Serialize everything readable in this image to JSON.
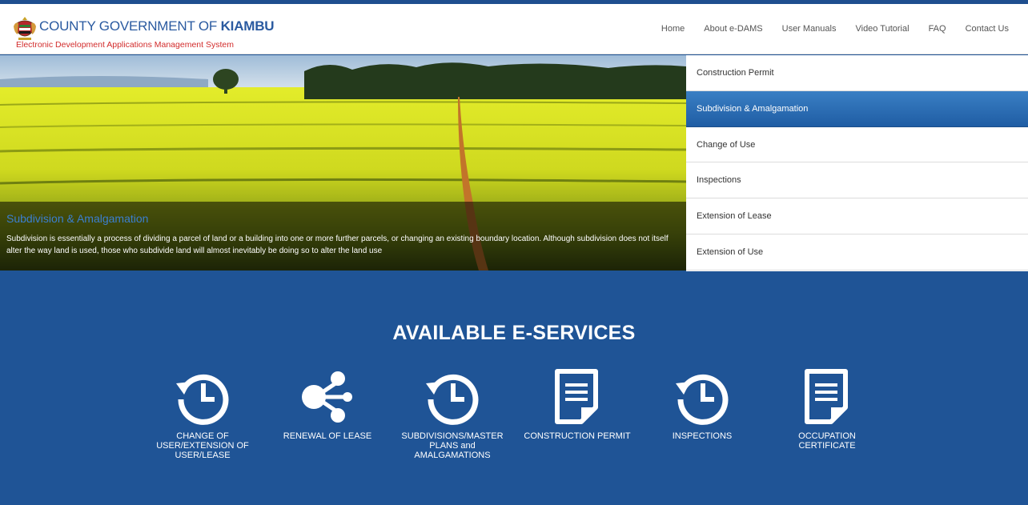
{
  "header": {
    "title_prefix": "COUNTY GOVERNMENT OF ",
    "title_bold": "KIAMBU",
    "subtitle": "Electronic Development Applications Management System",
    "nav": [
      {
        "label": "Home"
      },
      {
        "label": "About e-DAMS"
      },
      {
        "label": "User Manuals"
      },
      {
        "label": "Video Tutorial"
      },
      {
        "label": "FAQ"
      },
      {
        "label": "Contact Us"
      }
    ]
  },
  "hero": {
    "title": "Subdivision & Amalgamation",
    "text": "Subdivision is essentially a process of dividing a parcel of land or a building into one or more further parcels, or changing an existing boundary location. Although subdivision does not itself alter the way land is used, those who subdivide land will almost inevitably be doing so to alter the land use"
  },
  "side_menu": {
    "items": [
      {
        "label": "Construction Permit"
      },
      {
        "label": "Subdivision & Amalgamation"
      },
      {
        "label": "Change of Use"
      },
      {
        "label": "Inspections"
      },
      {
        "label": "Extension of Lease"
      },
      {
        "label": "Extension of Use"
      }
    ],
    "active_index": 1
  },
  "services": {
    "title": "AVAILABLE E-SERVICES",
    "items": [
      {
        "label": "CHANGE OF USER/EXTENSION OF USER/LEASE",
        "icon": "history-clock-icon"
      },
      {
        "label": "RENEWAL OF LEASE",
        "icon": "share-icon"
      },
      {
        "label": "SUBDIVISIONS/MASTER PLANS and AMALGAMATIONS",
        "icon": "history-clock-icon"
      },
      {
        "label": "CONSTRUCTION PERMIT",
        "icon": "document-icon"
      },
      {
        "label": "INSPECTIONS",
        "icon": "history-clock-icon"
      },
      {
        "label": "OCCUPATION CERTIFICATE",
        "icon": "document-icon"
      }
    ]
  },
  "colors": {
    "brand_blue": "#1f5496",
    "title_blue": "#2a5aa0",
    "subtitle_red": "#d22b2b",
    "active_menu": "#2a6db3"
  }
}
